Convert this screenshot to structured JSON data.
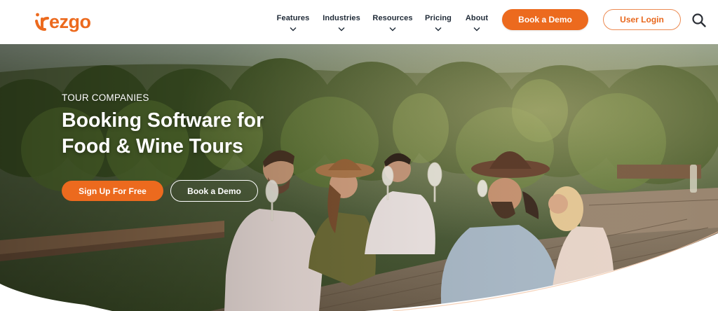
{
  "brand": {
    "name": "rezgo",
    "accent_color": "#ec6a1e",
    "text_color": "#1f2a37"
  },
  "nav": {
    "items": [
      {
        "label": "Features",
        "icon": "chevron-down-icon"
      },
      {
        "label": "Industries",
        "icon": "chevron-down-icon"
      },
      {
        "label": "Resources",
        "icon": "chevron-down-icon"
      },
      {
        "label": "Pricing",
        "icon": "chevron-down-icon"
      },
      {
        "label": "About",
        "icon": "chevron-down-icon"
      }
    ],
    "book_demo_label": "Book a Demo",
    "login_label": "User Login",
    "search_icon": "search-icon"
  },
  "hero": {
    "eyebrow": "TOUR COMPANIES",
    "title": "Booking Software for Food & Wine Tours",
    "primary_cta": "Sign Up For Free",
    "secondary_cta": "Book a Demo",
    "image": "friends-wine-tasting-vineyard-photo"
  }
}
